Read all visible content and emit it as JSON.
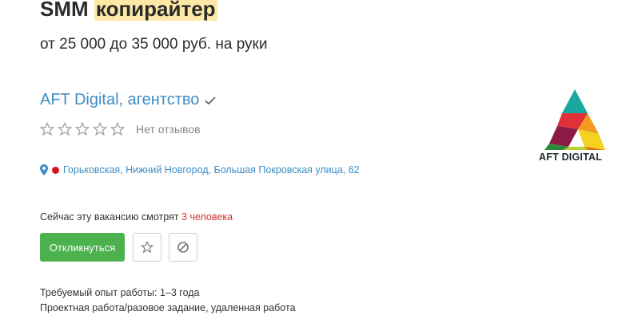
{
  "vacancy": {
    "title_prefix": "SMM",
    "title_highlight": "копирайтер",
    "salary": "от 25 000 до 35 000 руб. на руки"
  },
  "company": {
    "name": "AFT Digital, агентство",
    "reviews_text": "Нет отзывов",
    "stars_filled": 0,
    "logo_text": "AFT DIGITAL"
  },
  "location": {
    "metro_color": "#d6161e",
    "address": "Горьковская, Нижний Новгород, Большая Покровская улица, 62"
  },
  "watching": {
    "prefix": "Сейчас эту вакансию смотрят",
    "count": "3 человека"
  },
  "actions": {
    "apply_label": "Откликнуться",
    "favorite_icon": "star-icon",
    "hide_icon": "block-icon"
  },
  "details": {
    "experience": "Требуемый опыт работы: 1–3 года",
    "employment": "Проектная работа/разовое задание, удаленная работа"
  },
  "colors": {
    "accent_link": "#3d8ec4",
    "apply_button": "#4bb24e",
    "highlight": "#fde8a6"
  }
}
